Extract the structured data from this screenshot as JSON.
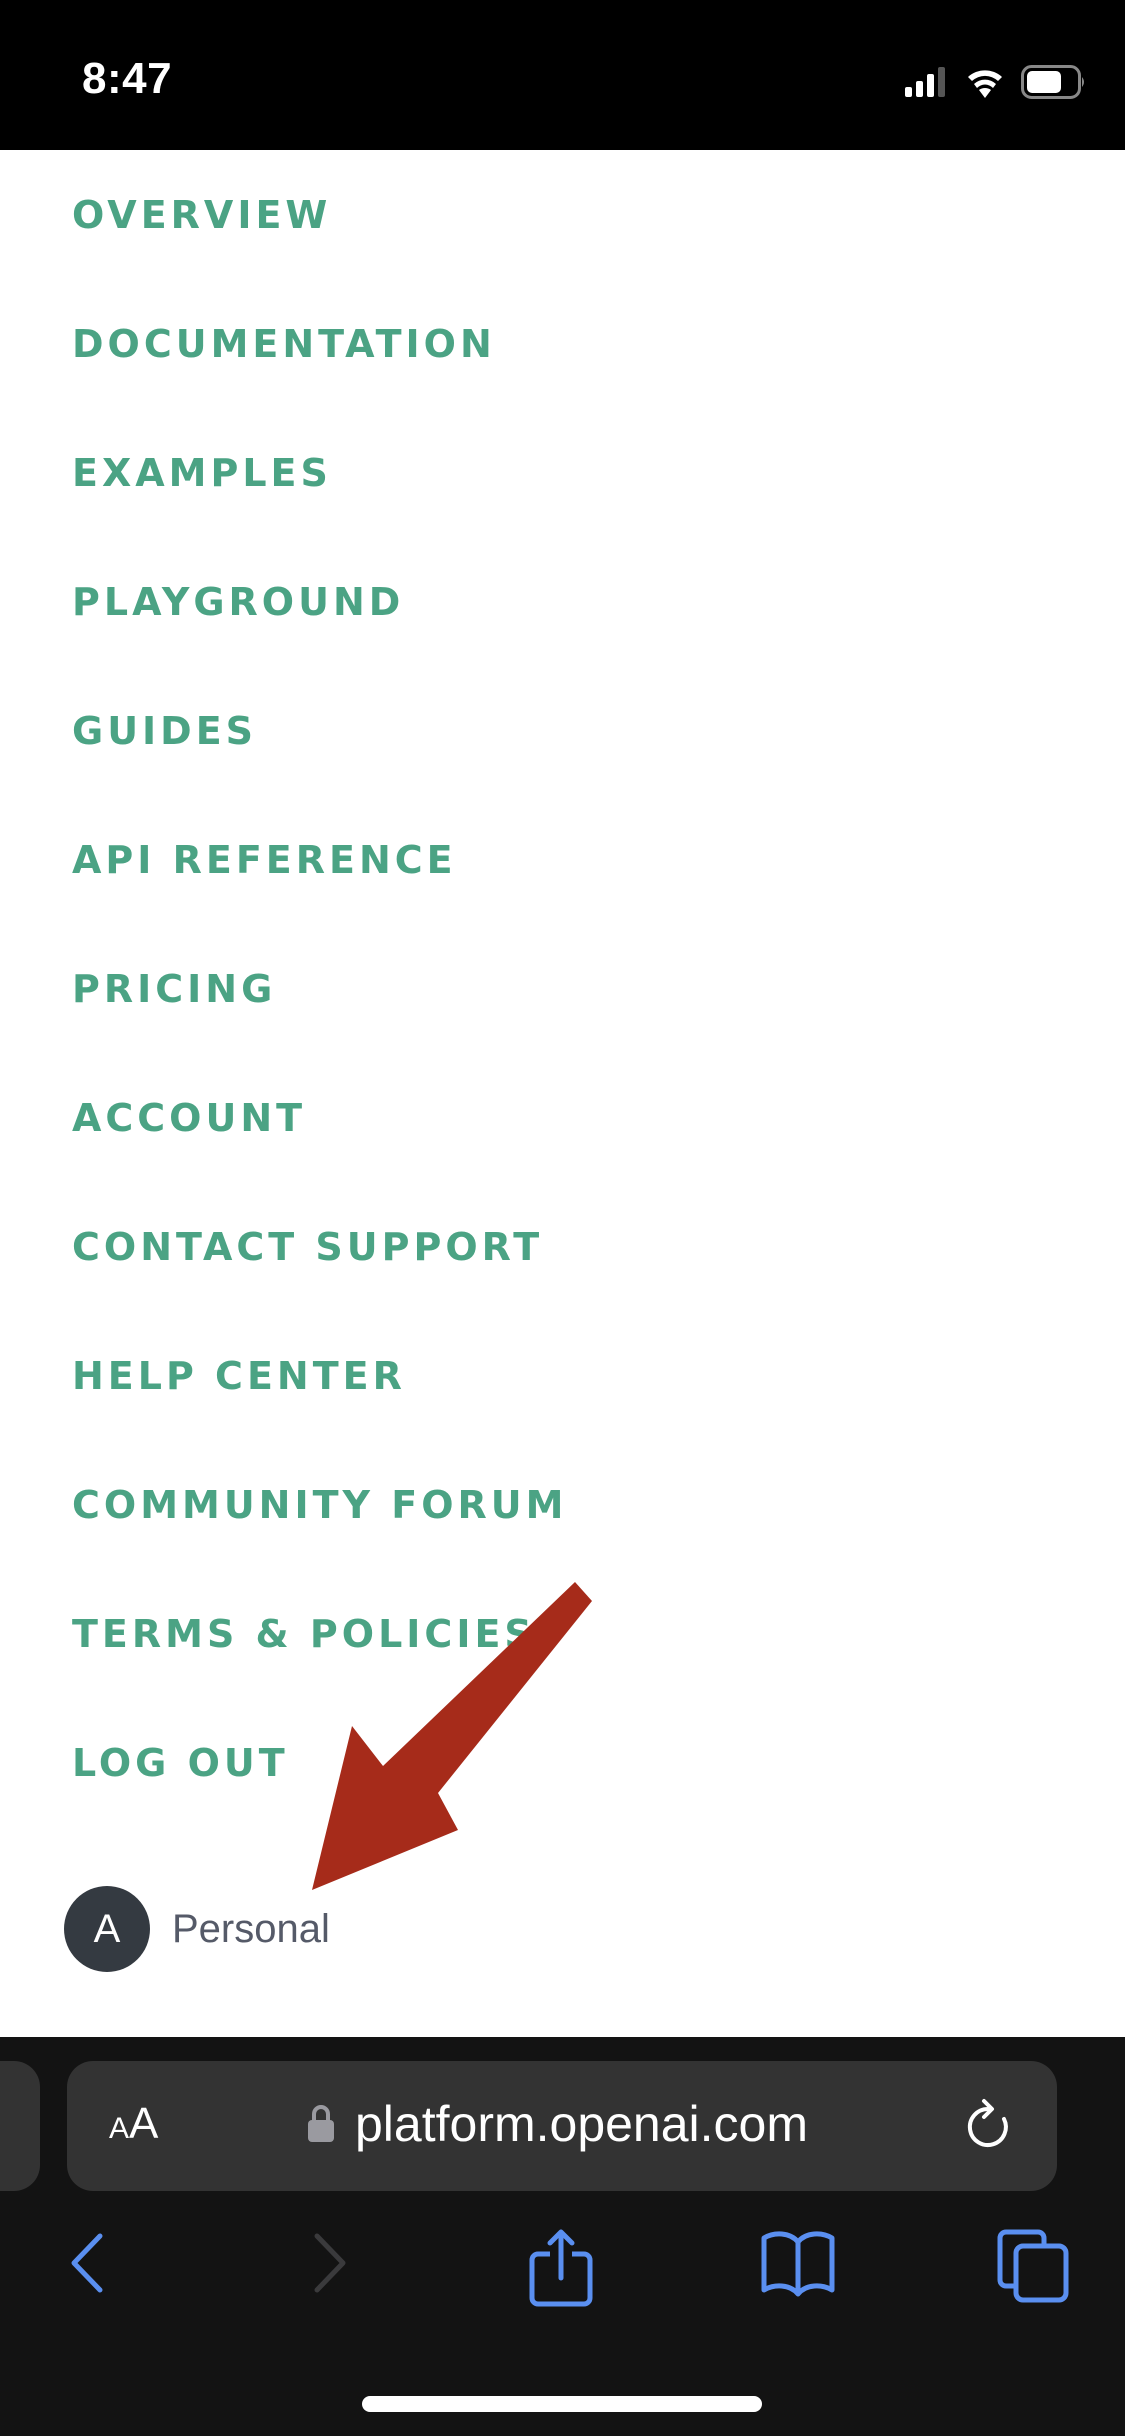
{
  "status_bar": {
    "time": "8:47",
    "icons": [
      "cellular-signal-icon",
      "wifi-icon",
      "battery-icon"
    ]
  },
  "menu": {
    "accent_color": "#4ba384",
    "items": [
      {
        "label": "OVERVIEW"
      },
      {
        "label": "DOCUMENTATION"
      },
      {
        "label": "EXAMPLES"
      },
      {
        "label": "PLAYGROUND"
      },
      {
        "label": "GUIDES"
      },
      {
        "label": "API REFERENCE"
      },
      {
        "label": "PRICING"
      },
      {
        "label": "ACCOUNT"
      },
      {
        "label": "CONTACT SUPPORT"
      },
      {
        "label": "HELP CENTER"
      },
      {
        "label": "COMMUNITY FORUM"
      },
      {
        "label": "TERMS & POLICIES"
      },
      {
        "label": "LOG OUT"
      }
    ]
  },
  "account": {
    "avatar_initial": "A",
    "label": "Personal"
  },
  "annotation": {
    "type": "arrow",
    "color": "#a62b1a",
    "points_to": "Personal"
  },
  "browser": {
    "text_size_small": "A",
    "text_size_big": "A",
    "url": "platform.openai.com",
    "accent_color": "#5a8ff0",
    "toolbar": [
      "back-icon",
      "forward-icon",
      "share-icon",
      "bookmarks-icon",
      "tabs-icon"
    ]
  }
}
